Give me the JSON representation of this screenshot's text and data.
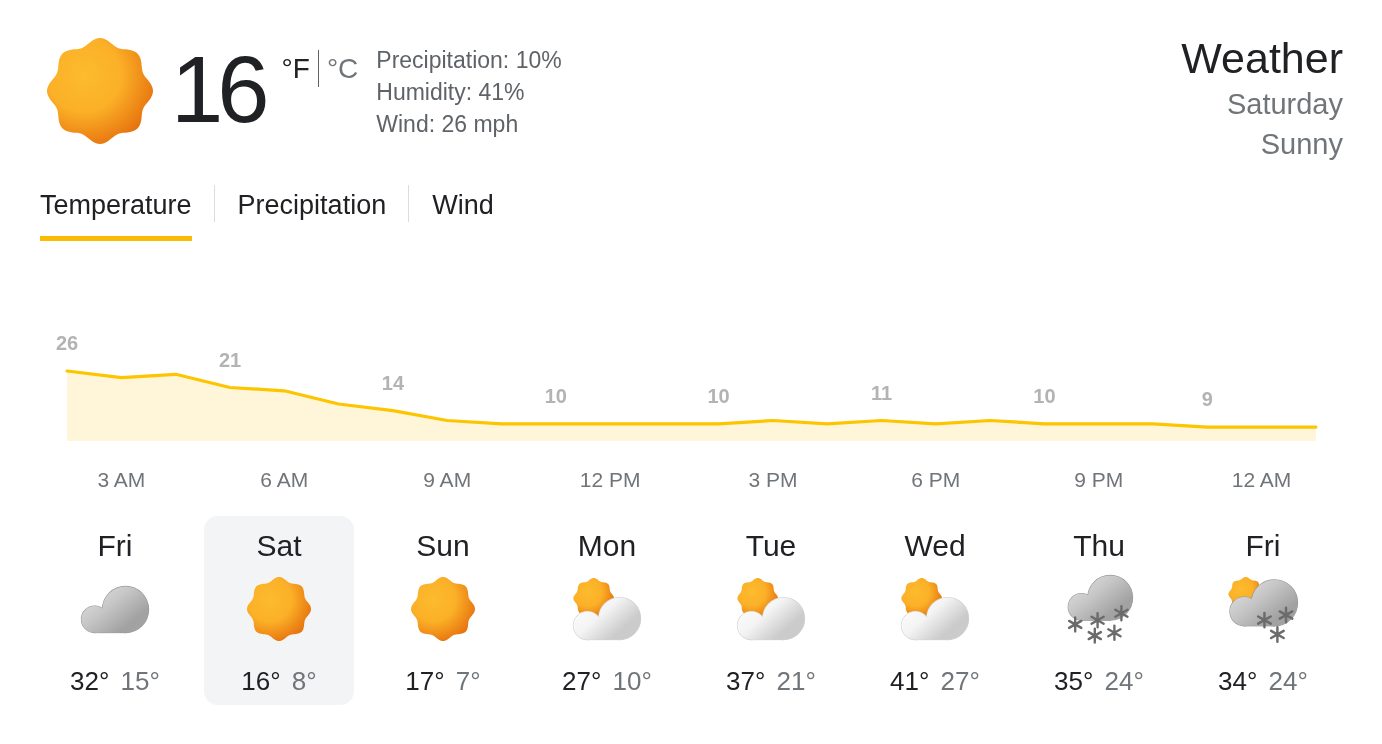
{
  "current": {
    "kind": "sunny",
    "temperature": "16",
    "units": [
      {
        "label": "°F",
        "selected": true
      },
      {
        "label": "°C",
        "selected": false
      }
    ],
    "details": [
      "Precipitation: 10%",
      "Humidity: 41%",
      "Wind: 26 mph"
    ]
  },
  "header": {
    "title": "Weather",
    "day": "Saturday",
    "condition": "Sunny"
  },
  "tabs": [
    {
      "label": "Temperature",
      "selected": true
    },
    {
      "label": "Precipitation",
      "selected": false
    },
    {
      "label": "Wind",
      "selected": false
    }
  ],
  "chart": {
    "chart_data": {
      "type": "area",
      "categories": [
        null,
        "3 AM",
        null,
        null,
        "6 AM",
        null,
        null,
        "9 AM",
        null,
        null,
        "12 PM",
        null,
        null,
        "3 PM",
        null,
        null,
        "6 PM",
        null,
        null,
        "9 PM",
        null,
        null,
        "12 AM",
        null
      ],
      "values": [
        26,
        24,
        25,
        21,
        20,
        16,
        14,
        11,
        10,
        10,
        10,
        10,
        10,
        11,
        10,
        11,
        10,
        11,
        10,
        10,
        10,
        9,
        9,
        9
      ],
      "value_labels": [
        "26",
        null,
        null,
        "21",
        null,
        null,
        "14",
        null,
        null,
        "10",
        null,
        null,
        "10",
        null,
        null,
        "11",
        null,
        null,
        "10",
        null,
        null,
        "9",
        null,
        null
      ],
      "color": "#fcc500"
    }
  },
  "forecast": [
    {
      "day": "Fri",
      "kind": "cloudy",
      "high": "32°",
      "low": "15°",
      "selected": false
    },
    {
      "day": "Sat",
      "kind": "sunny",
      "high": "16°",
      "low": "8°",
      "selected": true
    },
    {
      "day": "Sun",
      "kind": "sunny",
      "high": "17°",
      "low": "7°",
      "selected": false
    },
    {
      "day": "Mon",
      "kind": "partlycloudy",
      "high": "27°",
      "low": "10°",
      "selected": false
    },
    {
      "day": "Tue",
      "kind": "partlycloudy",
      "high": "37°",
      "low": "21°",
      "selected": false
    },
    {
      "day": "Wed",
      "kind": "partlycloudy",
      "high": "41°",
      "low": "27°",
      "selected": false
    },
    {
      "day": "Thu",
      "kind": "snow",
      "high": "35°",
      "low": "24°",
      "selected": false
    },
    {
      "day": "Fri",
      "kind": "sunsnow",
      "high": "34°",
      "low": "24°",
      "selected": false
    }
  ]
}
